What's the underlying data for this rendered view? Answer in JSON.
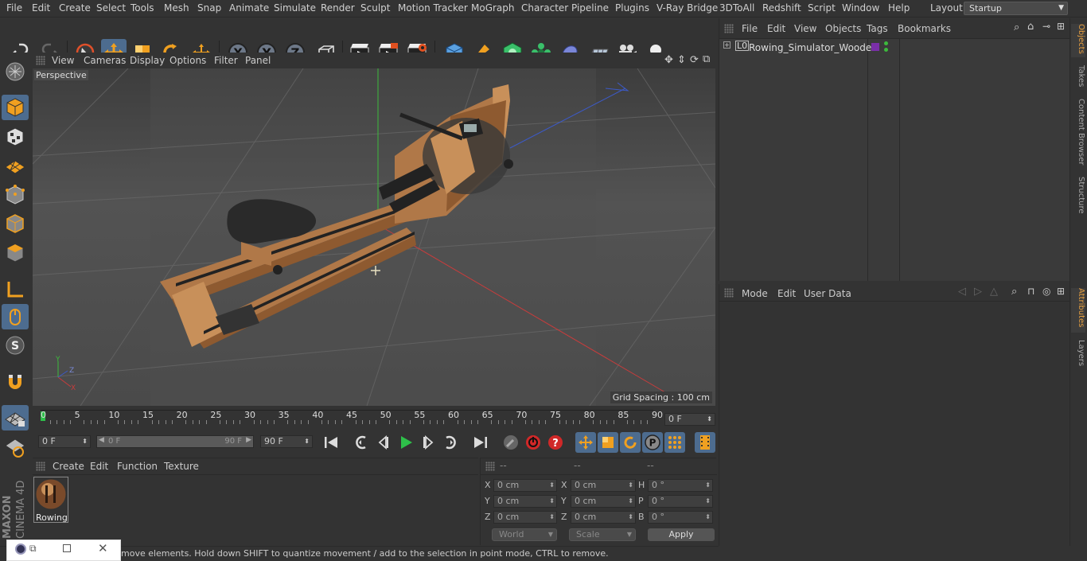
{
  "menubar": {
    "items": [
      "File",
      "Edit",
      "Create",
      "Select",
      "Tools",
      "Mesh",
      "Snap",
      "Animate",
      "Simulate",
      "Render",
      "Sculpt",
      "Motion Tracker",
      "MoGraph",
      "Character",
      "Pipeline",
      "Plugins",
      "V-Ray Bridge",
      "3DToAll",
      "Redshift",
      "Script",
      "Window",
      "Help"
    ],
    "layout_label": "Layout:",
    "layout_value": "Startup"
  },
  "viewport": {
    "menu": [
      "View",
      "Cameras",
      "Display",
      "Options",
      "Filter",
      "Panel"
    ],
    "label": "Perspective",
    "grid_spacing": "Grid Spacing : 100 cm"
  },
  "objects_panel": {
    "menu": [
      "File",
      "Edit",
      "View",
      "Objects",
      "Tags",
      "Bookmarks"
    ],
    "object_name": "Rowing_Simulator_Wooden",
    "tag_color": "#7a2fa8"
  },
  "attributes_panel": {
    "menu": [
      "Mode",
      "Edit",
      "User Data"
    ]
  },
  "right_tabs": [
    "Objects",
    "Takes",
    "Content Browser",
    "Structure",
    "Attributes",
    "Layers"
  ],
  "timeline": {
    "ticks": [
      "0",
      "5",
      "10",
      "15",
      "20",
      "25",
      "30",
      "35",
      "40",
      "45",
      "50",
      "55",
      "60",
      "65",
      "70",
      "75",
      "80",
      "85",
      "90"
    ],
    "current_frame_field": "0 F",
    "start_field": "0 F",
    "range_start": "0 F",
    "range_end": "90 F",
    "end_field": "90 F"
  },
  "material_panel": {
    "menu": [
      "Create",
      "Edit",
      "Function",
      "Texture"
    ],
    "material_name": "Rowing"
  },
  "coords_panel": {
    "headers": [
      "--",
      "--",
      "--"
    ],
    "rows": [
      {
        "a": "X",
        "av": "0 cm",
        "b": "X",
        "bv": "0 cm",
        "c": "H",
        "cv": "0 °"
      },
      {
        "a": "Y",
        "av": "0 cm",
        "b": "Y",
        "bv": "0 cm",
        "c": "P",
        "cv": "0 °"
      },
      {
        "a": "Z",
        "av": "0 cm",
        "b": "Z",
        "bv": "0 cm",
        "c": "B",
        "cv": "0 °"
      }
    ],
    "world": "World",
    "scale": "Scale",
    "apply": "Apply"
  },
  "statusbar": {
    "text": "move elements. Hold down SHIFT to quantize movement / add to the selection in point mode, CTRL to remove."
  },
  "brand": {
    "line1": "MAXON",
    "line2": "CINEMA 4D"
  },
  "colors": {
    "accent": "#4d6c8f",
    "x_axis": "#c83c3c",
    "y_axis": "#3cba3c",
    "z_axis": "#3c5ac8",
    "wood": "#c8905a"
  }
}
